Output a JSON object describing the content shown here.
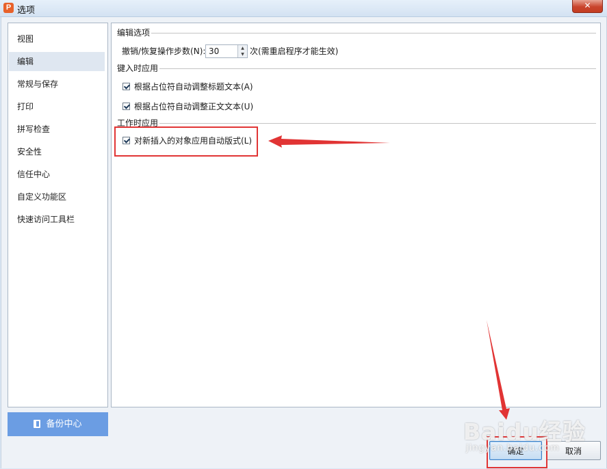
{
  "window": {
    "title": "选项",
    "app_icon": "P",
    "close_glyph": "✕"
  },
  "sidebar": {
    "items": [
      {
        "label": "视图",
        "active": false
      },
      {
        "label": "编辑",
        "active": true
      },
      {
        "label": "常规与保存",
        "active": false
      },
      {
        "label": "打印",
        "active": false
      },
      {
        "label": "拼写检查",
        "active": false
      },
      {
        "label": "安全性",
        "active": false
      },
      {
        "label": "信任中心",
        "active": false
      },
      {
        "label": "自定义功能区",
        "active": false
      },
      {
        "label": "快速访问工具栏",
        "active": false
      }
    ],
    "backup_label": "备份中心"
  },
  "panel": {
    "group_edit": {
      "title": "编辑选项",
      "undo_label": "撤销/恢复操作步数(N):",
      "undo_value": "30",
      "undo_suffix": "次(需重启程序才能生效)"
    },
    "group_typing": {
      "title": "键入时应用",
      "options": [
        {
          "label": "根据占位符自动调整标题文本(A)",
          "checked": true
        },
        {
          "label": "根据占位符自动调整正文文本(U)",
          "checked": true
        }
      ]
    },
    "group_work": {
      "title": "工作时应用",
      "options": [
        {
          "label": "对新插入的对象应用自动版式(L)",
          "checked": true
        }
      ]
    }
  },
  "footer": {
    "ok_label": "确定",
    "cancel_label": "取消"
  },
  "watermark": {
    "brand": "Baidu经验",
    "url": "jingyan.baidu.com"
  },
  "colors": {
    "accent": "#6b9de3",
    "annotation_red": "#e13434",
    "app_icon": "#e8622b"
  }
}
